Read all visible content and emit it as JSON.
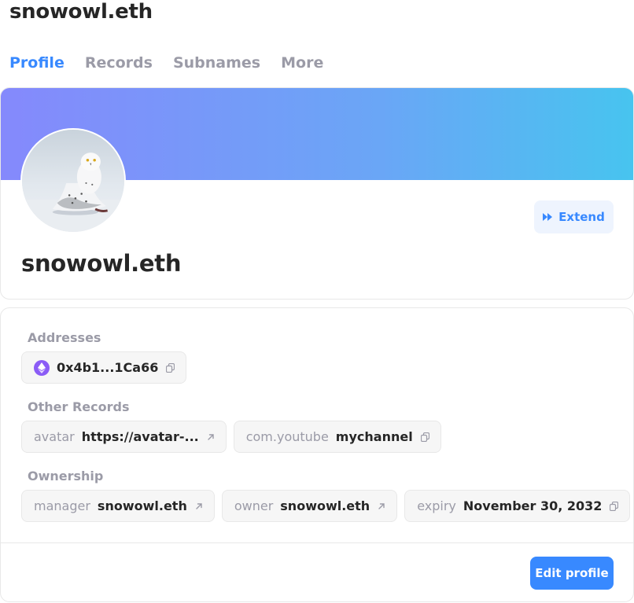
{
  "header": {
    "title": "snowowl.eth"
  },
  "tabs": [
    {
      "label": "Profile"
    },
    {
      "label": "Records"
    },
    {
      "label": "Subnames"
    },
    {
      "label": "More"
    }
  ],
  "profile": {
    "name": "snowowl.eth",
    "extend_label": "Extend",
    "banner_colors": [
      "#8589fc",
      "#47c4ef"
    ]
  },
  "records": {
    "addresses_label": "Addresses",
    "address": {
      "value": "0x4b1...1Ca66",
      "icon": "ethereum-icon"
    },
    "other_label": "Other Records",
    "other": [
      {
        "key": "avatar",
        "value": "https://avatar-...",
        "icon": "external-link-icon"
      },
      {
        "key": "com.youtube",
        "value": "mychannel",
        "icon": "copy-icon"
      }
    ],
    "ownership_label": "Ownership",
    "ownership": [
      {
        "key": "manager",
        "value": "snowowl.eth",
        "icon": "external-link-icon"
      },
      {
        "key": "owner",
        "value": "snowowl.eth",
        "icon": "external-link-icon"
      },
      {
        "key": "expiry",
        "value": "November 30, 2032",
        "icon": "copy-icon"
      }
    ]
  },
  "footer": {
    "edit_label": "Edit profile"
  },
  "colors": {
    "accent": "#3889ff",
    "muted": "#9b9ba7",
    "text": "#262626"
  }
}
